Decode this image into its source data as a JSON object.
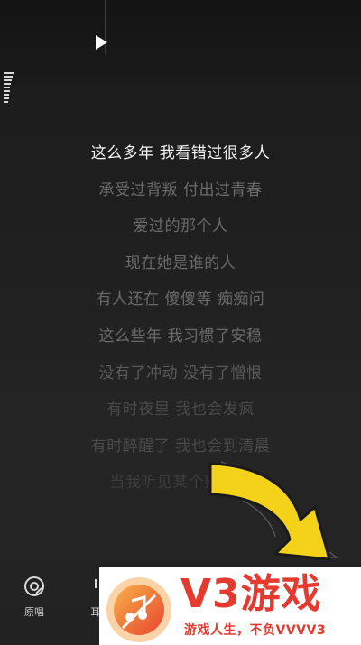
{
  "lyrics": [
    "这么多年 我看错过很多人",
    "承受过背叛 付出过青春",
    "爱过的那个人",
    "现在她是谁的人",
    "有人还在 傻傻等 痴痴问",
    "这么些年 我习惯了安稳",
    "没有了冲动 没有了憎恨",
    "有时夜里 我也会发疯",
    "有时醉醒了 我也会到清晨",
    "当我听见某个熟悉的"
  ],
  "bottom_bar": {
    "original_label": "原唱",
    "earphone_label": "耳"
  },
  "banner": {
    "brand": "V3游戏",
    "slogan": "游戏人生，不负VVVV3"
  },
  "colors": {
    "accent_yellow": "#f4d21a",
    "brand_red": "#e53a2f",
    "brand_orange": "#f39a3c"
  },
  "icons": [
    "play-icon",
    "equalizer-icon",
    "original-vocal-icon",
    "yellow-arrow",
    "v3-logo-icon"
  ]
}
